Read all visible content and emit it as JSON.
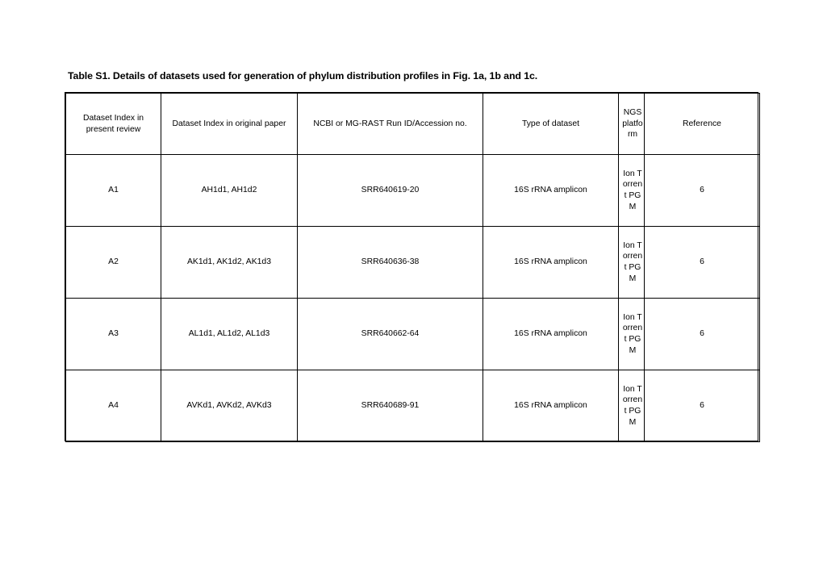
{
  "caption": "Table S1. Details of datasets used for generation of phylum distribution profiles in Fig. 1a, 1b and 1c.",
  "table": {
    "columns": [
      {
        "id": "index_present",
        "label": "Dataset Index in present review"
      },
      {
        "id": "index_original",
        "label": "Dataset Index in original paper"
      },
      {
        "id": "run_id",
        "label": "NCBI or MG-RAST Run ID/Accession no."
      },
      {
        "id": "dataset_type",
        "label": "Type of dataset"
      },
      {
        "id": "ngs_platform",
        "label": "NGS platform"
      },
      {
        "id": "reference",
        "label": "Reference"
      }
    ],
    "rows": [
      {
        "index_present": "A1",
        "index_original": "AH1d1, AH1d2",
        "run_id": "SRR640619-20",
        "dataset_type": "16S rRNA amplicon",
        "ngs_platform": "Ion Torrent PGM",
        "reference": "6"
      },
      {
        "index_present": "A2",
        "index_original": "AK1d1, AK1d2, AK1d3",
        "run_id": "SRR640636-38",
        "dataset_type": "16S rRNA amplicon",
        "ngs_platform": "Ion Torrent PGM",
        "reference": "6"
      },
      {
        "index_present": "A3",
        "index_original": "AL1d1, AL1d2, AL1d3",
        "run_id": "SRR640662-64",
        "dataset_type": "16S rRNA amplicon",
        "ngs_platform": "Ion Torrent PGM",
        "reference": "6"
      },
      {
        "index_present": "A4",
        "index_original": "AVKd1, AVKd2, AVKd3",
        "run_id": "SRR640689-91",
        "dataset_type": "16S rRNA amplicon",
        "ngs_platform": "Ion Torrent PGM",
        "reference": "6"
      }
    ]
  }
}
